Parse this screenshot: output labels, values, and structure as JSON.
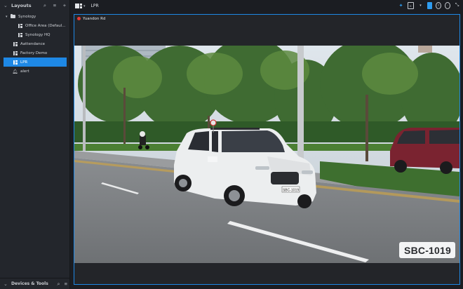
{
  "sidebar": {
    "header": {
      "title": "Layouts"
    },
    "tree": {
      "folder": "Synology",
      "children": [
        "Office Area (Defaul...",
        "Synology HQ"
      ],
      "items": [
        "Aattendance",
        "Factory Demo",
        "LPR",
        "alert"
      ]
    },
    "footer": {
      "title": "Devices & Tools"
    }
  },
  "topbar": {
    "layout_name": "LPR"
  },
  "viewer": {
    "camera_name": "Yuandon Rd",
    "plate_text": "SBC-1019",
    "car_plate_text": "SBC-1019"
  },
  "colors": {
    "accent": "#1e88e5",
    "recording": "#e53935",
    "background": "#1b1d22",
    "sidebar": "#23262c"
  },
  "icons": [
    "chevron-down-icon",
    "search-icon",
    "sort-icon",
    "add-icon",
    "folder-icon",
    "layout-icon",
    "bell-icon",
    "pin-icon",
    "window-icon",
    "blue-square-icon",
    "info-icon",
    "clock-icon",
    "collapse-icon"
  ]
}
